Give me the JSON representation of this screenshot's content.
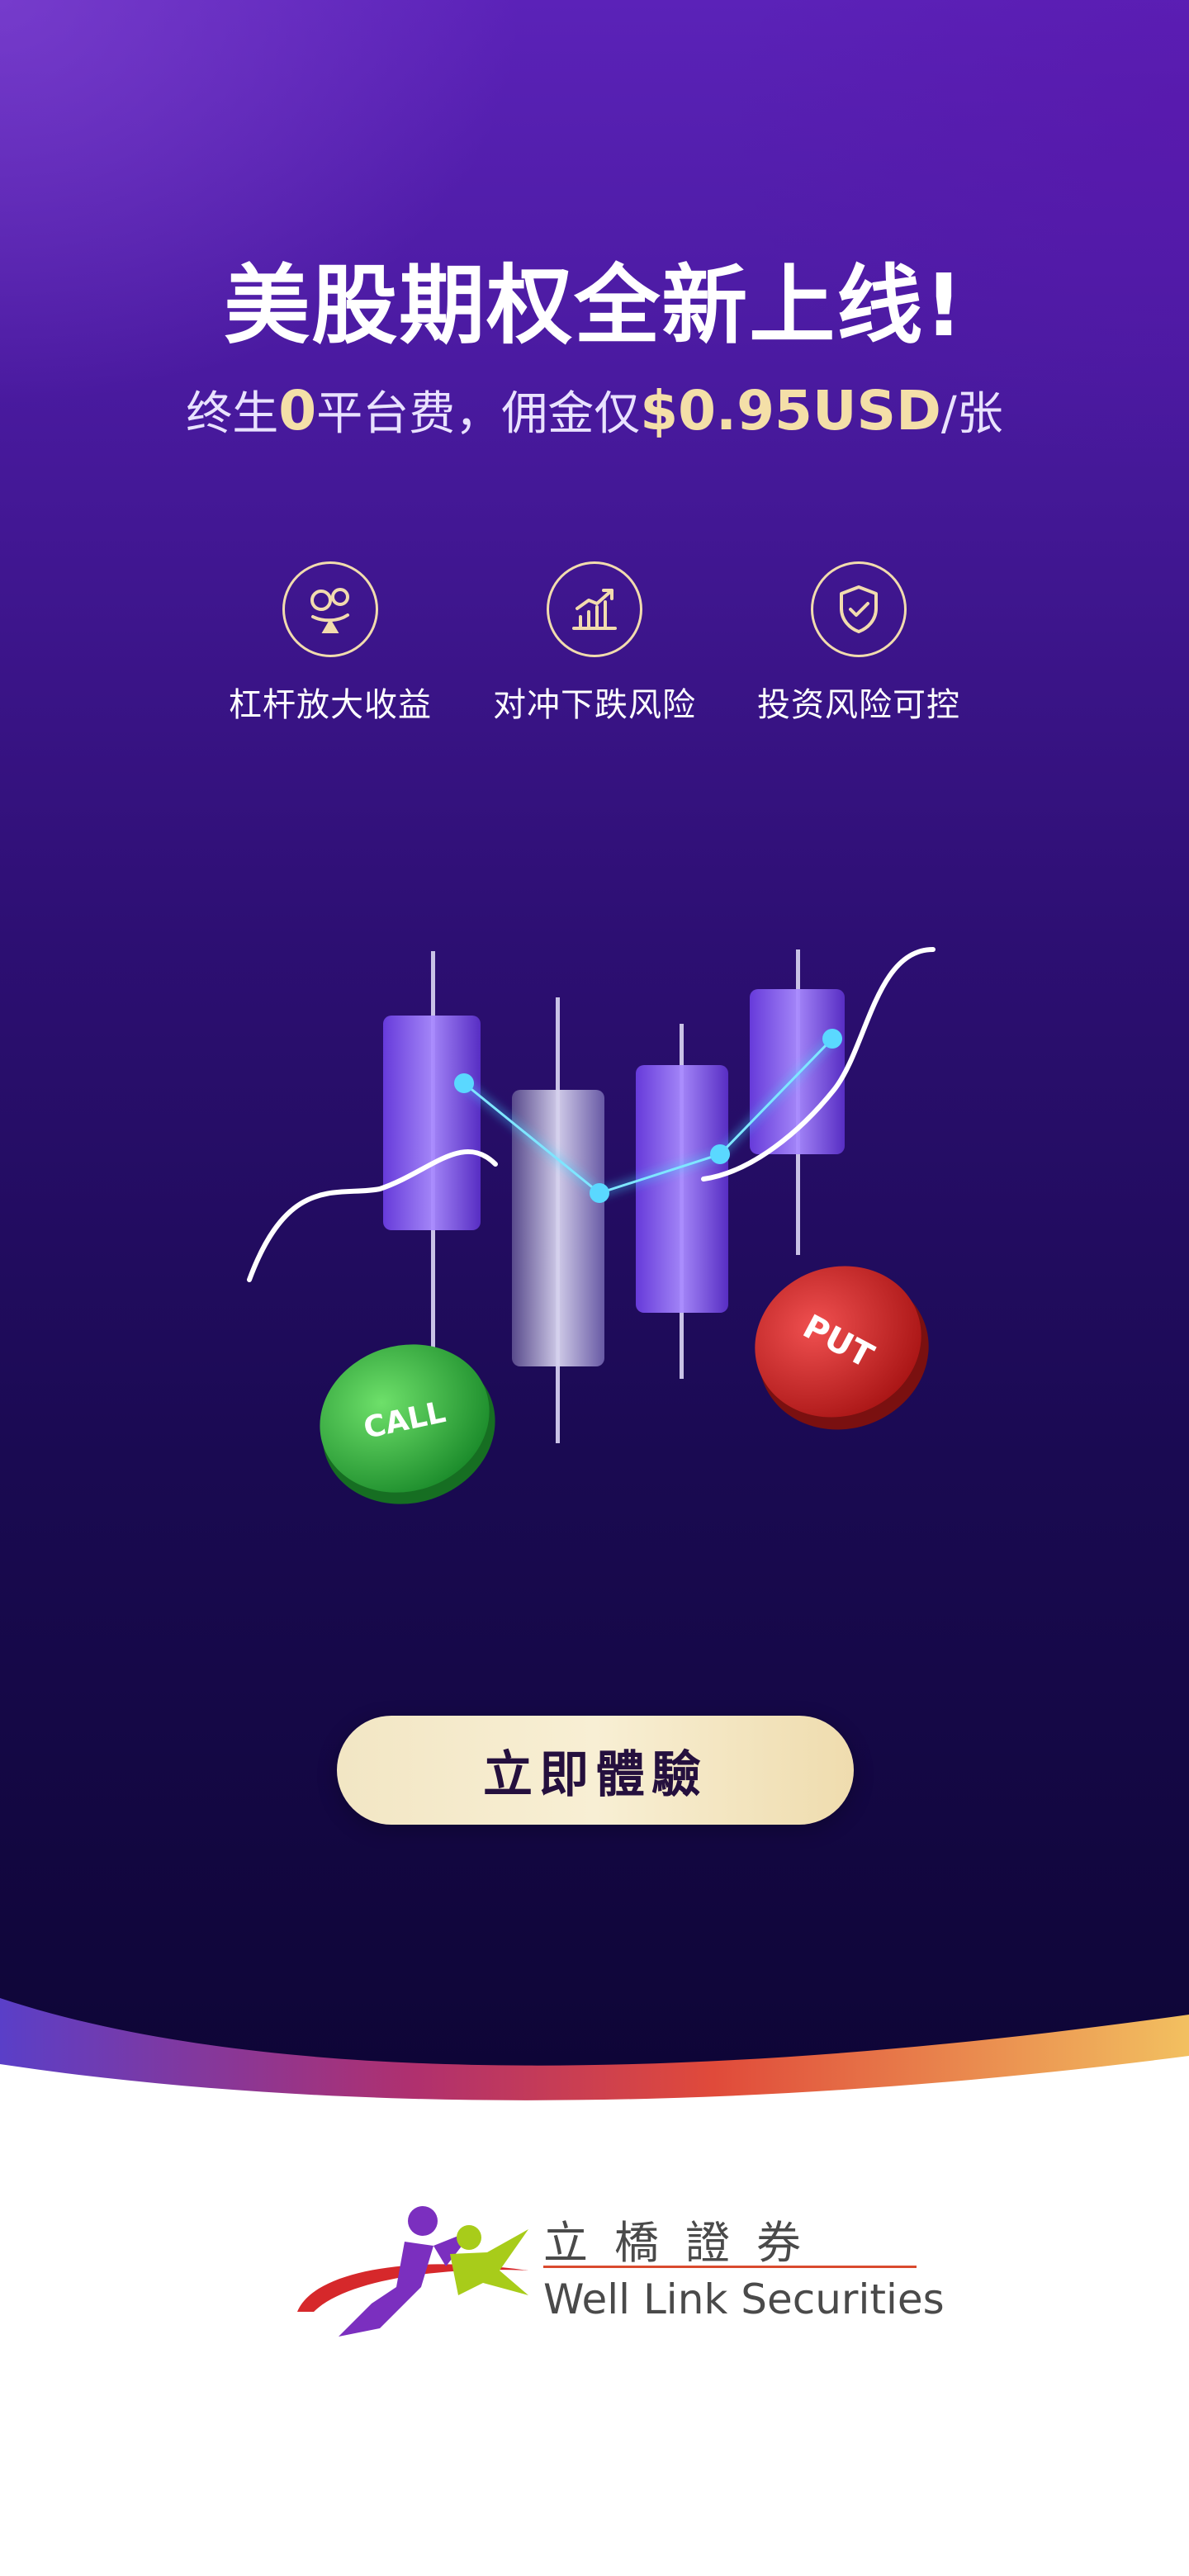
{
  "headline": "美股期权全新上线!",
  "subheadline": {
    "prefix": "终生",
    "zero": "0",
    "mid": "平台费，佣金仅",
    "price": "$0.95USD",
    "suffix": "/张"
  },
  "features": [
    {
      "label": "杠杆放大收益",
      "icon": "coins-balance-icon"
    },
    {
      "label": "对冲下跌风险",
      "icon": "bar-chart-growth-icon"
    },
    {
      "label": "投资风险可控",
      "icon": "shield-check-icon"
    }
  ],
  "illustration": {
    "call_label": "CALL",
    "put_label": "PUT"
  },
  "cta": {
    "label": "立即體驗"
  },
  "brand": {
    "name_cn": "立橋證券",
    "name_en": "Well Link Securities"
  },
  "colors": {
    "background_top": "#5b22b8",
    "background_bottom": "#0e0536",
    "accent_gold": "#f4dfa8",
    "cta_background": "#f5eacb",
    "call_green": "#2fb24a",
    "put_red": "#d62828"
  }
}
